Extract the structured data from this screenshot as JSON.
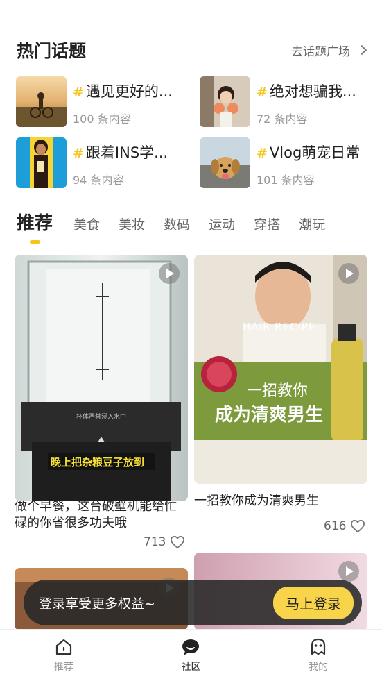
{
  "hot_topics": {
    "title": "热门话题",
    "more_label": "去话题广场",
    "hash": "#",
    "items": [
      {
        "title": "遇见更好的...",
        "count": "100 条内容"
      },
      {
        "title": "绝对想骗我...",
        "count": "72 条内容"
      },
      {
        "title": "跟着INS学...",
        "count": "94 条内容"
      },
      {
        "title": "Vlog萌宠日常",
        "count": "101 条内容"
      }
    ]
  },
  "tabs": [
    "推荐",
    "美食",
    "美妆",
    "数码",
    "运动",
    "穿搭",
    "潮玩"
  ],
  "feed": {
    "cards": [
      {
        "title": "做个早餐，这台破壁机能给忙碌的你省很多功夫哦",
        "likes": "713",
        "overlay_caption": "晚上把杂粮豆子放到",
        "cup_text": "杯体严禁浸入水中"
      },
      {
        "title": "一招教你成为清爽男生",
        "likes": "616",
        "brand_text": "HAIR RECIPE",
        "overlay_line1": "一招教你",
        "overlay_line2": "成为清爽男生"
      }
    ]
  },
  "login_banner": {
    "text": "登录享受更多权益~",
    "button": "马上登录"
  },
  "bottom_nav": [
    {
      "label": "推荐",
      "icon": "house-icon"
    },
    {
      "label": "社区",
      "icon": "chat-bubble-icon"
    },
    {
      "label": "我的",
      "icon": "ghost-face-icon"
    }
  ],
  "colors": {
    "accent": "#f5c518",
    "banner_bg": "#282828",
    "login_button": "#f8d44a"
  }
}
